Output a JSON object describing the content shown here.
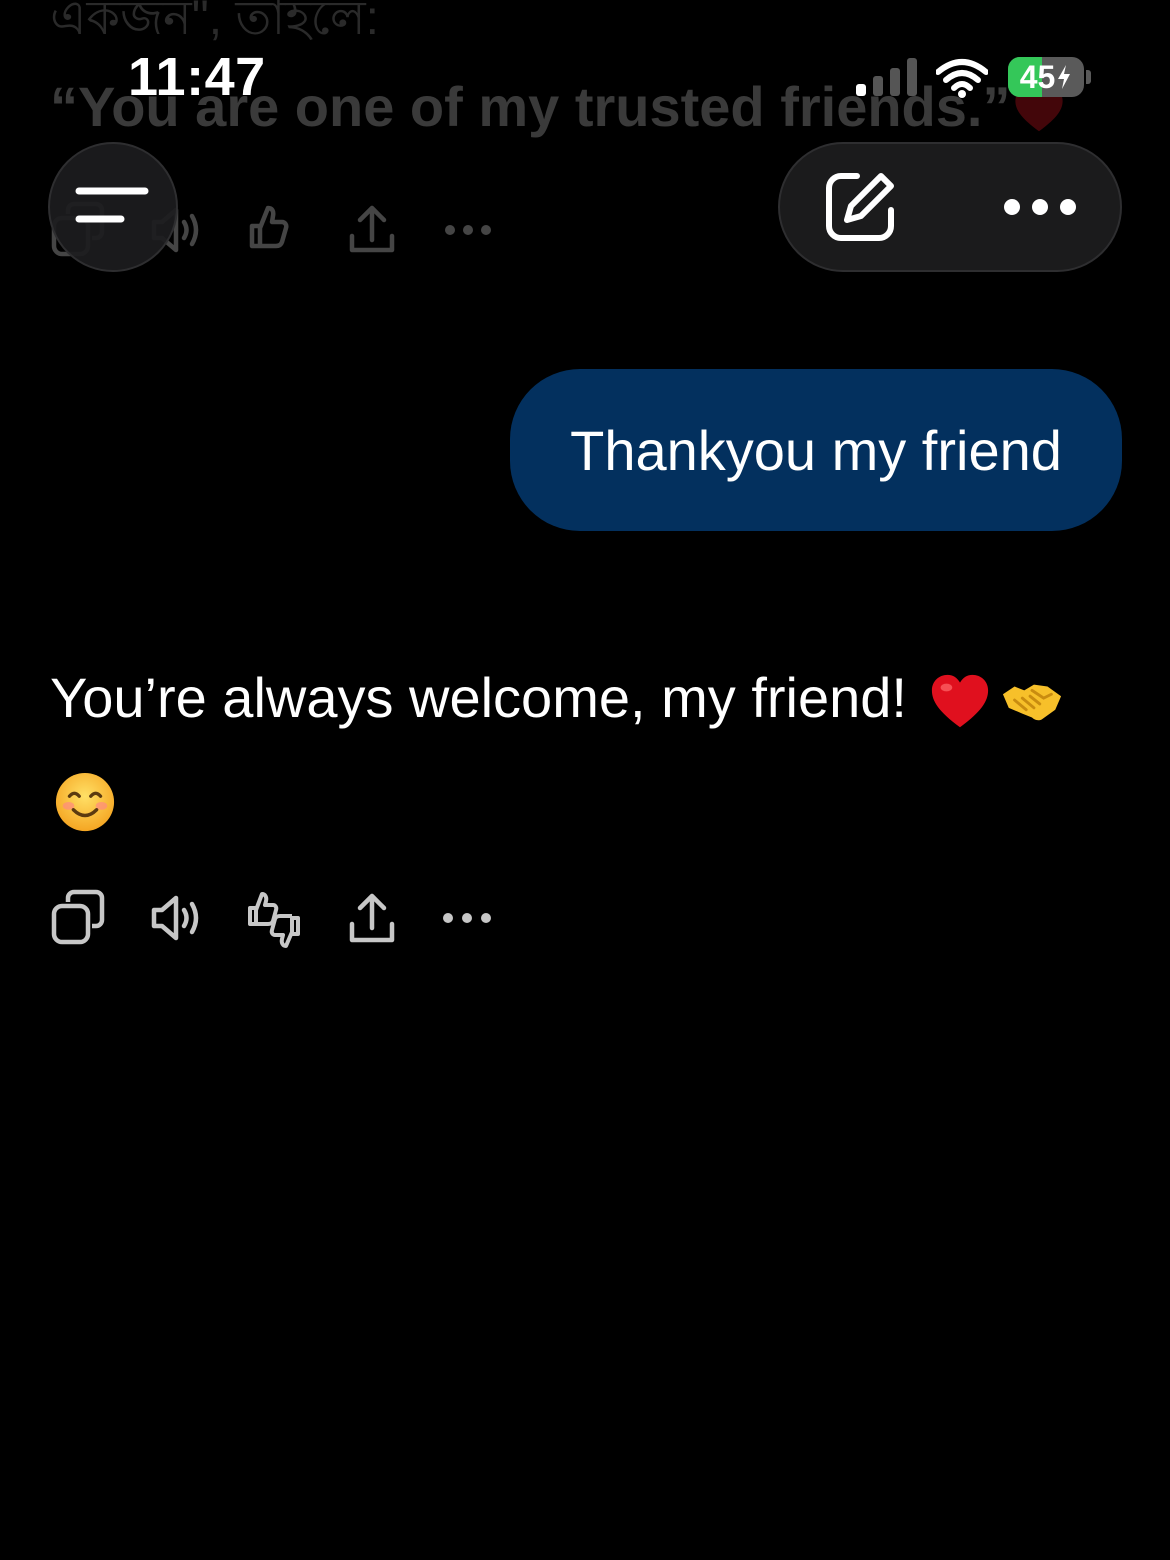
{
  "status_bar": {
    "time": "11:47",
    "battery_percent": 45,
    "battery_label": "45",
    "battery_charging": true,
    "signal_bars_active": 1,
    "signal_bars_total": 4
  },
  "background_content": {
    "line_1": "একজন\", তাহলে:",
    "line_2": "“You are one of my trusted friends.”"
  },
  "header": {
    "menu_icon": "menu-lines-icon",
    "compose_icon": "compose-pencil-icon",
    "more_icon": "ellipsis-icon"
  },
  "messages": {
    "user": {
      "text": "Thankyou my friend"
    },
    "assistant": {
      "text": "You’re always welcome, my friend!",
      "emojis": [
        "red-heart",
        "handshake",
        "smiling-face"
      ]
    }
  },
  "message_actions": [
    "copy-icon",
    "speaker-icon",
    "thumb-vote-icon",
    "share-icon",
    "ellipsis-icon"
  ],
  "colors": {
    "background": "#000000",
    "user_bubble": "#03305e",
    "battery_green": "#34c759",
    "icon_gray": "#c7c7c7"
  }
}
